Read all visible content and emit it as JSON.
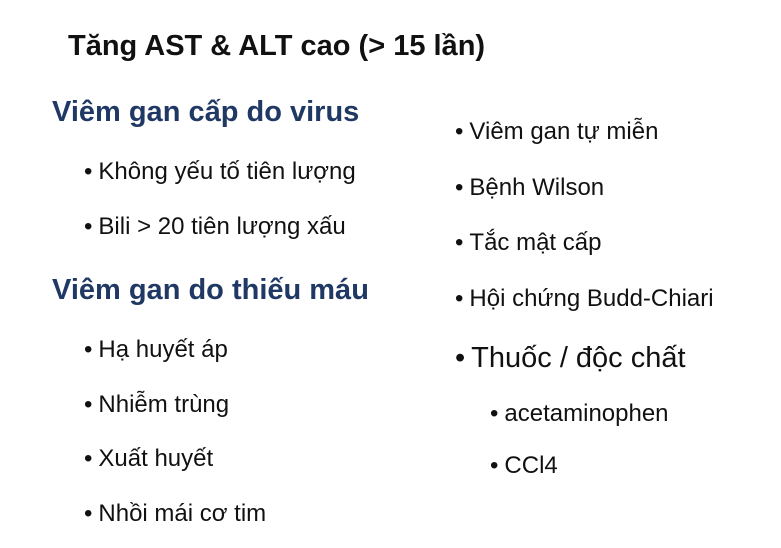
{
  "title": "Tăng AST & ALT cao (> 15 lần)",
  "bullet_char": "•",
  "left_column": {
    "sections": [
      {
        "heading": "Viêm gan cấp do virus",
        "items": [
          "Không yếu tố tiên lượng",
          "Bili > 20 tiên lượng xấu"
        ]
      },
      {
        "heading": "Viêm gan do thiếu máu",
        "items": [
          "Hạ huyết áp",
          "Nhiễm trùng",
          "Xuất huyết",
          "Nhồi mái cơ tim"
        ]
      }
    ]
  },
  "right_column": {
    "items": [
      "Viêm gan tự miễn",
      "Bệnh Wilson",
      "Tắc mật cấp",
      "Hội chứng Budd-Chiari",
      "Thuốc / độc chất"
    ],
    "sub_items": [
      "acetaminophen",
      "CCl4"
    ]
  },
  "colors": {
    "heading": "#1f3864",
    "text": "#111111",
    "background": "#ffffff"
  }
}
